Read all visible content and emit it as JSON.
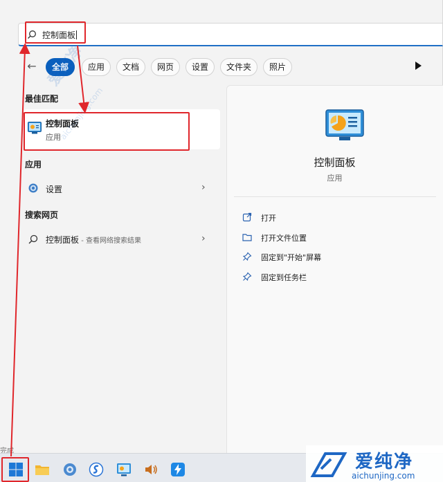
{
  "search": {
    "value": "控制面板"
  },
  "filters": {
    "items": [
      {
        "label": "全部",
        "active": true
      },
      {
        "label": "应用"
      },
      {
        "label": "文档"
      },
      {
        "label": "网页"
      },
      {
        "label": "设置"
      },
      {
        "label": "文件夹"
      },
      {
        "label": "照片"
      }
    ]
  },
  "left": {
    "best_match_title": "最佳匹配",
    "best_match": {
      "title": "控制面板",
      "subtitle": "应用"
    },
    "apps_title": "应用",
    "apps": [
      {
        "label": "设置"
      }
    ],
    "web_title": "搜索网页",
    "web": [
      {
        "label": "控制面板",
        "suffix": " - 查看网络搜索结果"
      }
    ]
  },
  "right": {
    "title": "控制面板",
    "subtitle": "应用",
    "actions": [
      {
        "label": "打开",
        "icon": "open-external-icon"
      },
      {
        "label": "打开文件位置",
        "icon": "folder-icon"
      },
      {
        "label": "固定到\"开始\"屏幕",
        "icon": "pin-icon"
      },
      {
        "label": "固定到任务栏",
        "icon": "pin-icon"
      }
    ]
  },
  "status_text": "完成",
  "watermark": {
    "brand": "爱纯净",
    "url": "aichunjing.com",
    "diag_brand": "爱纯净",
    "diag_url": "aichunjing.com"
  },
  "colors": {
    "accent": "#0a5fbd",
    "highlight": "#e0262b",
    "brand": "#1e67c4"
  },
  "taskbar": {
    "icons": [
      "windows-start-icon",
      "file-explorer-icon",
      "settings-icon",
      "sogou-icon",
      "control-panel-icon",
      "volume-icon",
      "app-icon"
    ]
  }
}
